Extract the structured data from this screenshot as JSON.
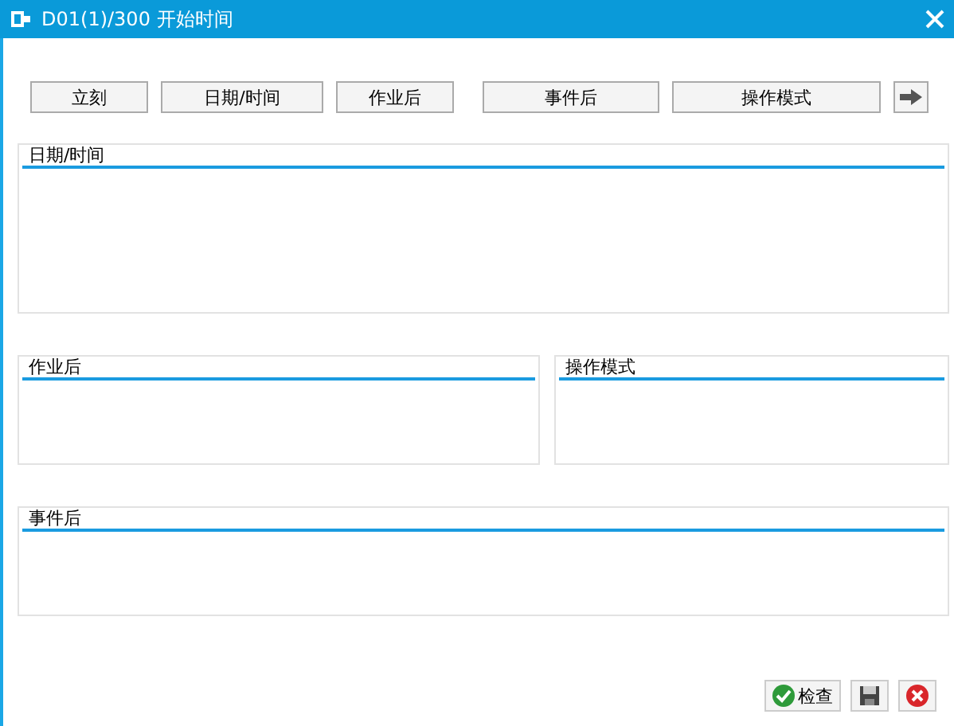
{
  "window": {
    "title": "D01(1)/300 开始时间"
  },
  "buttons": [
    "立刻",
    "日期/时间",
    "作业后",
    "事件后",
    "操作模式"
  ],
  "groups": {
    "date_time": {
      "title": "日期/时间"
    },
    "after_job": {
      "title": "作业后"
    },
    "operation_mode": {
      "title": "操作模式"
    },
    "after_event": {
      "title": "事件后"
    }
  },
  "footer": {
    "check": {
      "label": "检查"
    }
  }
}
